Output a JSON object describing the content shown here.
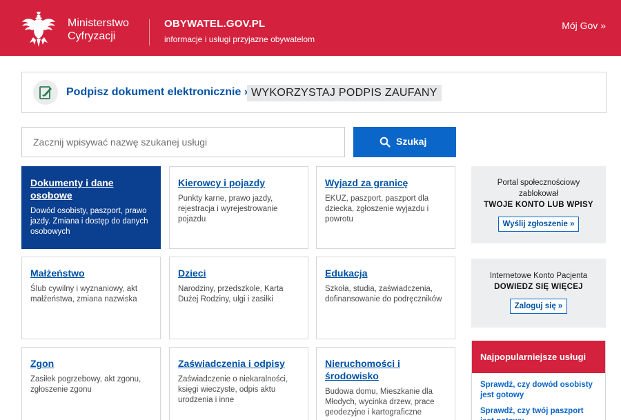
{
  "header": {
    "ministry_line1": "Ministerstwo",
    "ministry_line2": "Cyfryzacji",
    "brand": "OBYWATEL.GOV.PL",
    "tagline": "informacje i usługi przyjazne obywatelom",
    "account_link": "Mój Gov »",
    "color": "#d4213d"
  },
  "banner": {
    "icon": "signature-document-icon",
    "link": "Podpisz dokument elektronicznie »",
    "tag": "WYKORZYSTAJ PODPIS ZAUFANY"
  },
  "search": {
    "placeholder": "Zacznij wpisywać nazwę szukanej usługi",
    "button_label": "Szukaj",
    "button_icon": "search-icon",
    "button_color": "#0a66c8"
  },
  "tiles": [
    {
      "title": "Dokumenty i dane osobowe",
      "desc": "Dowód osobisty, paszport, prawo jazdy. Zmiana i dostęp do danych osobowych",
      "active": true
    },
    {
      "title": "Kierowcy i pojazdy",
      "desc": "Punkty karne, prawo jazdy, rejestracja i wyrejestrowanie pojazdu"
    },
    {
      "title": "Wyjazd za granicę",
      "desc": "EKUZ, paszport, paszport dla dziecka, zgłoszenie wyjazdu i powrotu"
    },
    {
      "title": "Małżeństwo",
      "desc": "Ślub cywilny i wyznaniowy, akt małżeństwa, zmiana nazwiska"
    },
    {
      "title": "Dzieci",
      "desc": "Narodziny, przedszkole, Karta Dużej Rodziny, ulgi i zasiłki"
    },
    {
      "title": "Edukacja",
      "desc": "Szkoła, studia, zaświadczenia, dofinansowanie do podręczników"
    },
    {
      "title": "Zgon",
      "desc": "Zasiłek pogrzebowy, akt zgonu, zgłoszenie zgonu"
    },
    {
      "title": "Zaświadczenia i odpisy",
      "desc": "Zaświadczenie o niekaralności, księgi wieczyste, odpis aktu urodzenia i inne"
    },
    {
      "title": "Nieruchomości i środowisko",
      "desc": "Budowa domu, Mieszkanie dla Młodych, wycinka drzew, prace geodezyjne i kartograficzne"
    }
  ],
  "sidebar": {
    "report": {
      "line1": "Portal społecznościowy",
      "line2": "zablokował",
      "highlight": "TWOJE KONTO LUB WPISY",
      "button": "Wyślij zgłoszenie »"
    },
    "ikp": {
      "line1": "Internetowe Konto Pacjenta",
      "highlight": "DOWIEDZ SIĘ WIĘCEJ",
      "button": "Zaloguj się »"
    },
    "popular": {
      "title": "Najpopularniejsze usługi",
      "items": [
        "Sprawdź, czy dowód osobisty jest gotowy",
        "Sprawdź, czy twój paszport jest gotowy"
      ]
    }
  }
}
